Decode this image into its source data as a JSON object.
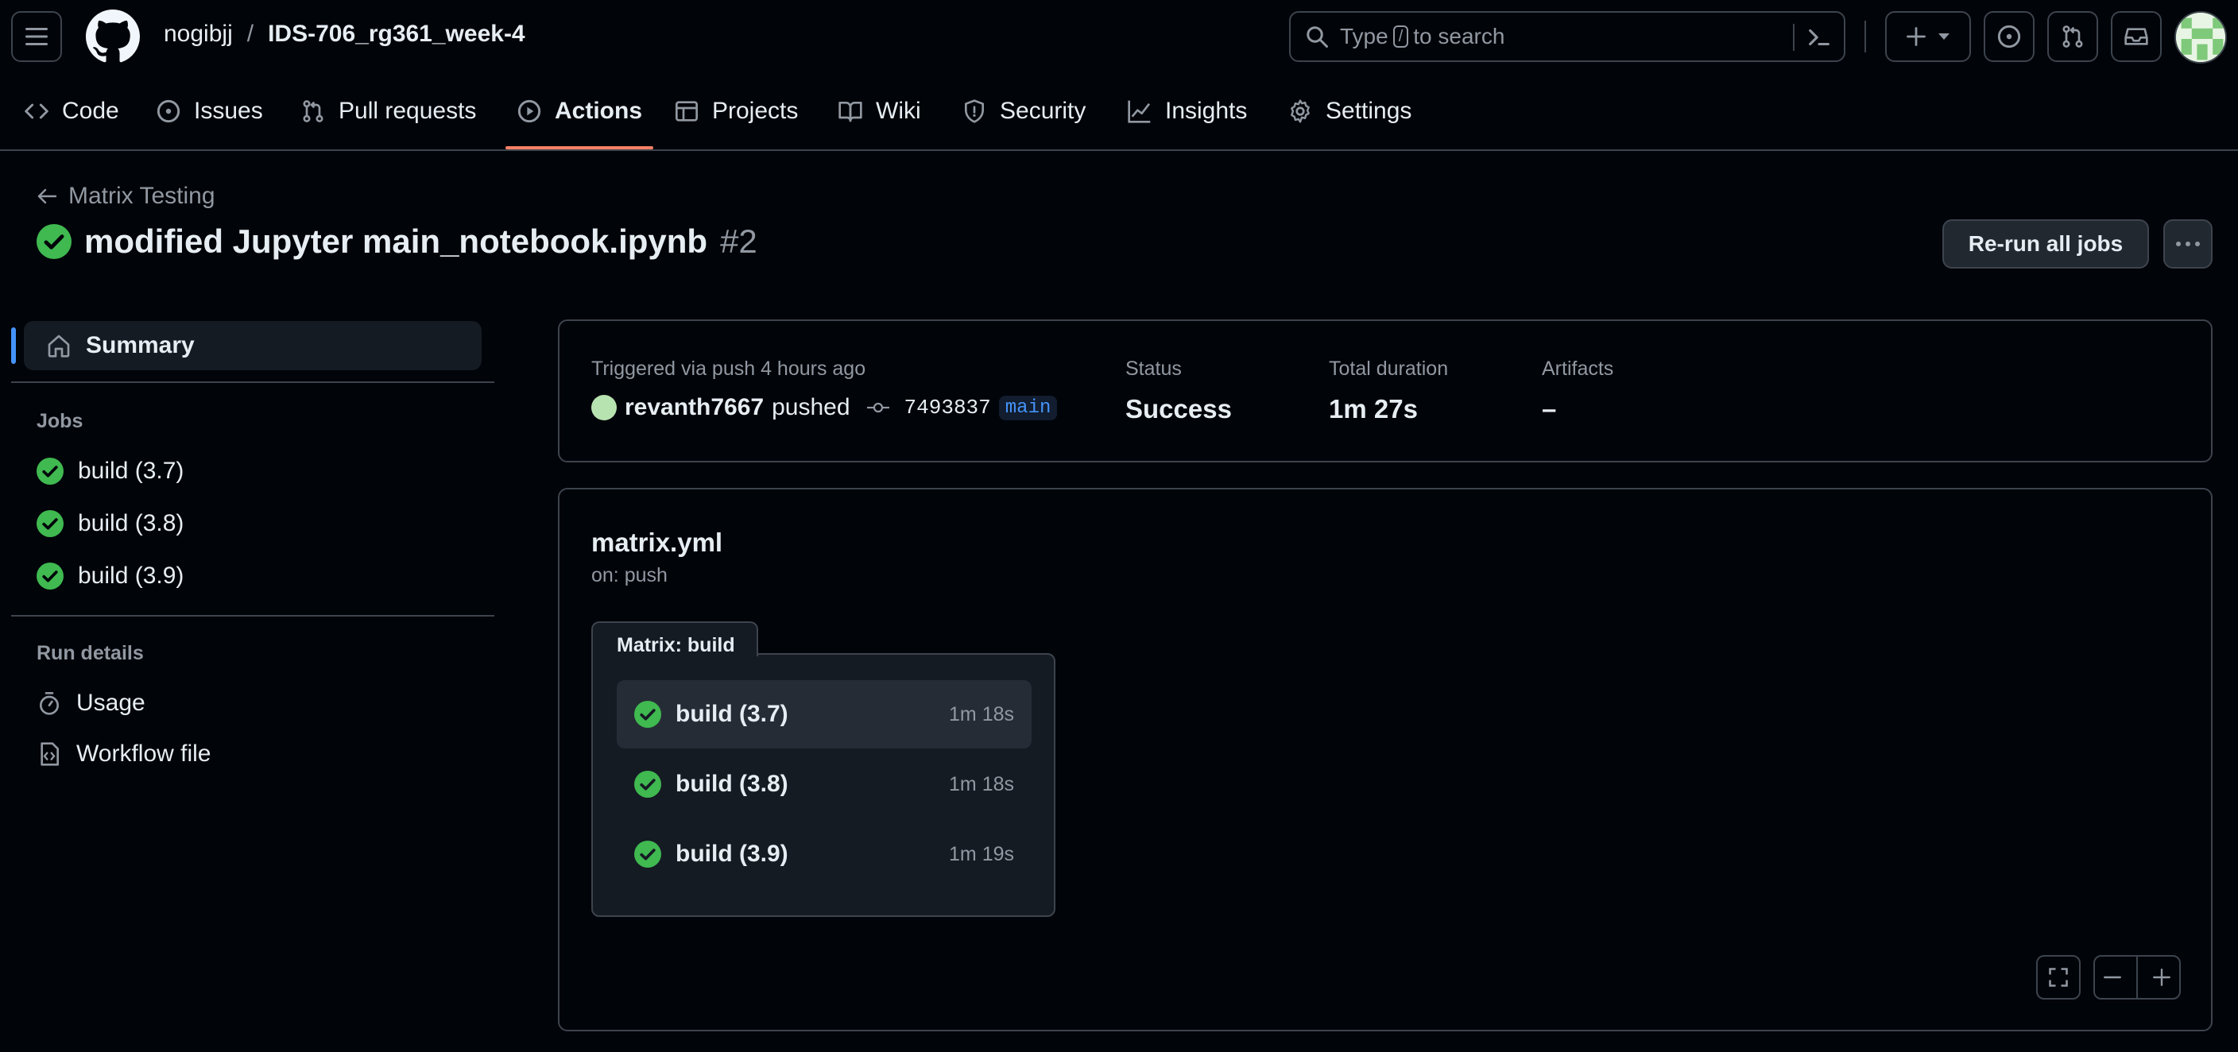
{
  "header": {
    "owner": "nogibjj",
    "separator": "/",
    "repo": "IDS-706_rg361_week-4",
    "search": {
      "prefix": "Type",
      "key": "/",
      "suffix": "to search"
    }
  },
  "repo_nav": {
    "items": [
      {
        "label": "Code",
        "icon": "code-icon"
      },
      {
        "label": "Issues",
        "icon": "issue-icon"
      },
      {
        "label": "Pull requests",
        "icon": "pull-request-icon"
      },
      {
        "label": "Actions",
        "icon": "play-icon",
        "active": true
      },
      {
        "label": "Projects",
        "icon": "table-icon"
      },
      {
        "label": "Wiki",
        "icon": "book-icon"
      },
      {
        "label": "Security",
        "icon": "shield-icon"
      },
      {
        "label": "Insights",
        "icon": "graph-icon"
      },
      {
        "label": "Settings",
        "icon": "gear-icon"
      }
    ]
  },
  "run": {
    "back_label": "Matrix Testing",
    "title": "modified Jupyter main_notebook.ipynb",
    "number": "#2",
    "rerun_label": "Re-run all jobs"
  },
  "sidebar": {
    "summary_label": "Summary",
    "jobs_heading": "Jobs",
    "jobs": [
      "build (3.7)",
      "build (3.8)",
      "build (3.9)"
    ],
    "run_details_heading": "Run details",
    "usage_label": "Usage",
    "workflow_file_label": "Workflow file"
  },
  "summary": {
    "triggered": "Triggered via push 4 hours ago",
    "user": "revanth7667",
    "action": "pushed",
    "sha": "7493837",
    "branch": "main",
    "status_label": "Status",
    "status_value": "Success",
    "duration_label": "Total duration",
    "duration_value": "1m 27s",
    "artifacts_label": "Artifacts",
    "artifacts_value": "–"
  },
  "workflow": {
    "name": "matrix.yml",
    "trigger": "on: push",
    "matrix_label": "Matrix: build",
    "jobs": [
      {
        "name": "build (3.7)",
        "duration": "1m 18s"
      },
      {
        "name": "build (3.8)",
        "duration": "1m 18s"
      },
      {
        "name": "build (3.9)",
        "duration": "1m 19s"
      }
    ]
  },
  "colors": {
    "success": "#3fb950",
    "accent": "#4493f8",
    "active_tab": "#f78166"
  }
}
